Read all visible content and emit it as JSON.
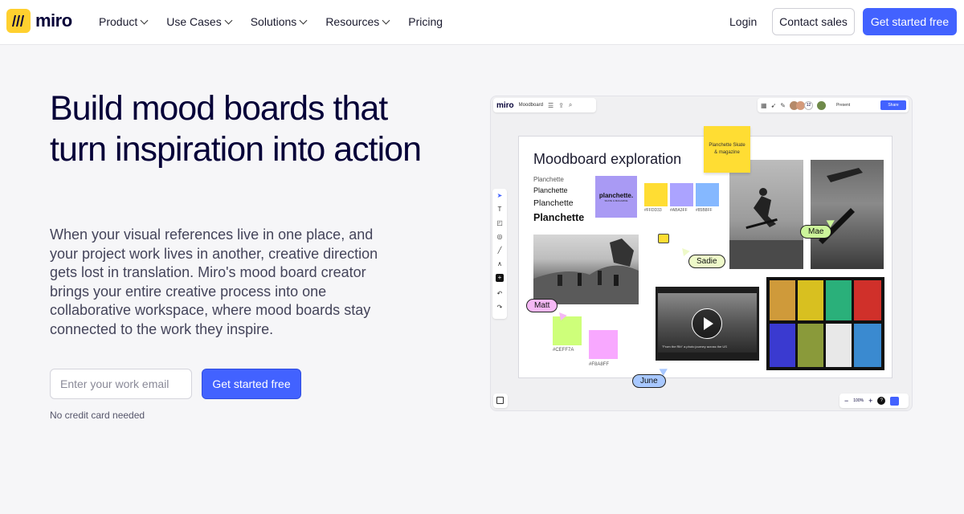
{
  "nav": {
    "logo_text": "miro",
    "menu": [
      {
        "label": "Product",
        "has_dropdown": true
      },
      {
        "label": "Use Cases",
        "has_dropdown": true
      },
      {
        "label": "Solutions",
        "has_dropdown": true
      },
      {
        "label": "Resources",
        "has_dropdown": true
      },
      {
        "label": "Pricing",
        "has_dropdown": false
      }
    ],
    "login": "Login",
    "contact_sales": "Contact sales",
    "get_started": "Get started free"
  },
  "hero": {
    "headline": "Build mood boards that turn inspiration into action",
    "description": "When your visual references live in one place, and your project work lives in another, creative direction gets lost in translation. Miro's mood board creator brings your entire creative process into one collaborative workspace, where mood boards stay connected to the work they inspire.",
    "email_placeholder": "Enter your work email",
    "cta": "Get started free",
    "note": "No credit card needed"
  },
  "board": {
    "app_name": "miro",
    "board_name": "Moodboard",
    "avatar_count": "12",
    "present_label": "Present",
    "share_label": "Share",
    "canvas_title": "Moodboard exploration",
    "font_samples": [
      "Planchette",
      "Planchette",
      "Planchette",
      "Planchette"
    ],
    "logo_tile": {
      "title": "planchette.",
      "subtitle": "SKATE & MAGAZINE"
    },
    "swatches": [
      {
        "hex": "#FFDD33",
        "label": "#FFDD33"
      },
      {
        "hex": "#ABA3FF",
        "label": "#ABA3FF"
      },
      {
        "hex": "#85B8FF",
        "label": "#85B8FF"
      }
    ],
    "sticky_note": "Planchette Skate & magazine",
    "sticky_swatches": [
      {
        "hex": "#CEFF7A",
        "label": "#CEFF7A"
      },
      {
        "hex": "#F8A8FF",
        "label": "#F8A8FF"
      }
    ],
    "collaborators": [
      {
        "name": "Mae",
        "color": "#ccf59a"
      },
      {
        "name": "Sadie",
        "color": "#eef9c9"
      },
      {
        "name": "Matt",
        "color": "#f5b8f5"
      },
      {
        "name": "June",
        "color": "#a8c8ff"
      }
    ],
    "video_caption": "\"From the Rib\" a photo journey across the US",
    "zoom_controls": [
      "−",
      "100%",
      "+",
      "?"
    ]
  },
  "colors": {
    "brand_yellow": "#ffd02f",
    "accent_blue": "#4262ff",
    "text_dark": "#050038"
  }
}
